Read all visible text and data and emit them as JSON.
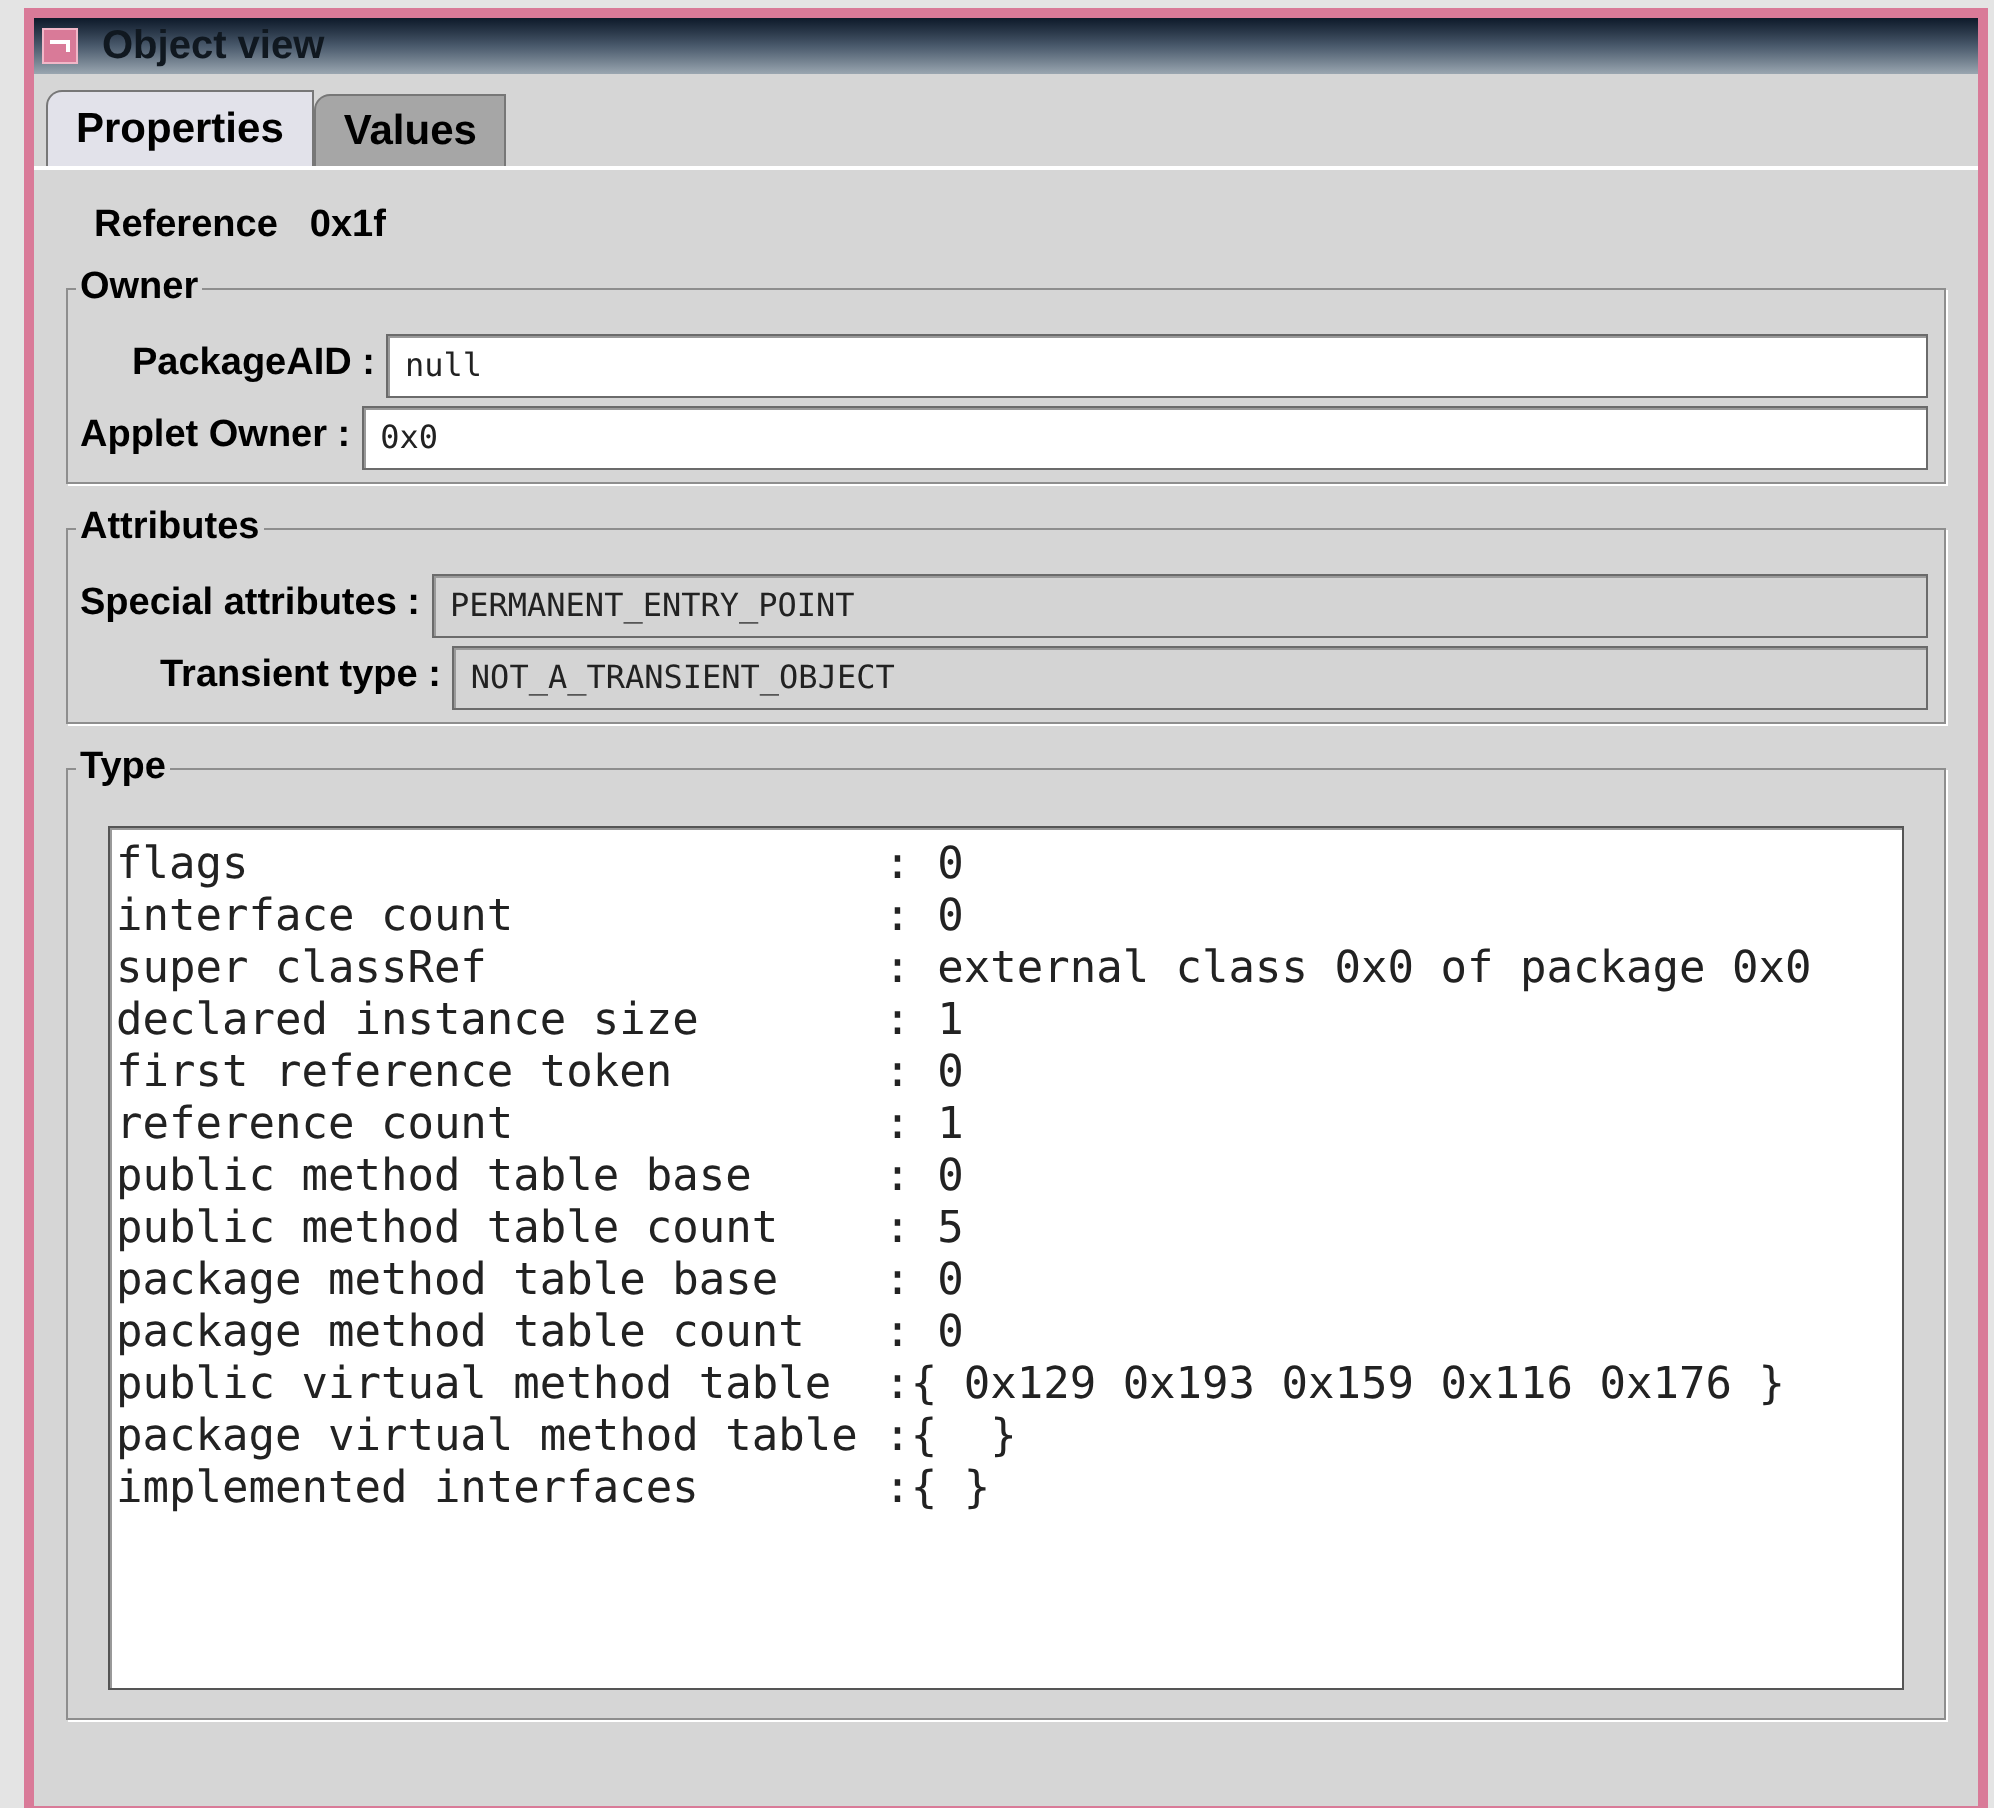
{
  "window": {
    "title": "Object view"
  },
  "tabs": [
    {
      "label": "Properties",
      "selected": true
    },
    {
      "label": "Values",
      "selected": false
    }
  ],
  "reference": {
    "label": "Reference",
    "value": "0x1f"
  },
  "owner": {
    "title": "Owner",
    "fields": [
      {
        "label": "PackageAID :",
        "value": "null",
        "disabled": false
      },
      {
        "label": "Applet Owner :",
        "value": "0x0",
        "disabled": false
      }
    ]
  },
  "attributes": {
    "title": "Attributes",
    "fields": [
      {
        "label": "Special attributes :",
        "value": "PERMANENT_ENTRY_POINT",
        "disabled": true
      },
      {
        "label": "Transient type :",
        "value": "NOT_A_TRANSIENT_OBJECT",
        "disabled": true
      }
    ]
  },
  "type": {
    "title": "Type",
    "lines": [
      "flags                        : 0",
      "interface count              : 0",
      "super classRef               : external class 0x0 of package 0x0",
      "declared instance size       : 1",
      "first reference token        : 0",
      "reference count              : 1",
      "public method table base     : 0",
      "public method table count    : 5",
      "package method table base    : 0",
      "package method table count   : 0",
      "public virtual method table  :{ 0x129 0x193 0x159 0x116 0x176 }",
      "package virtual method table :{  }",
      "implemented interfaces       :{ }"
    ]
  }
}
